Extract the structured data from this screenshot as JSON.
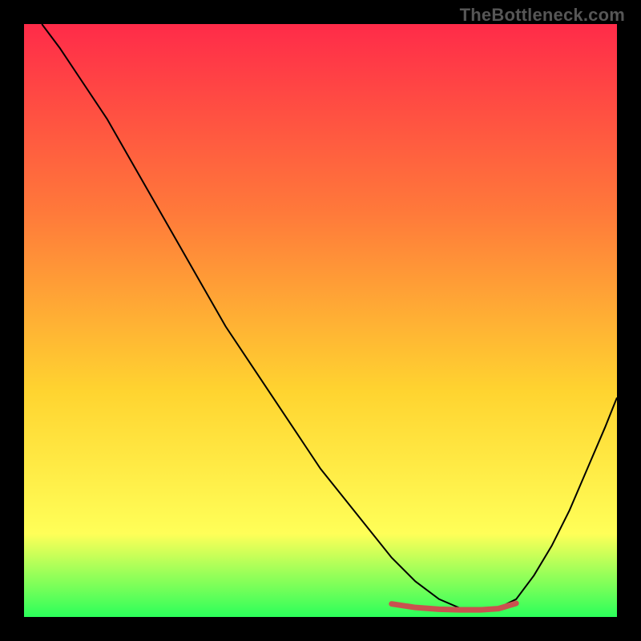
{
  "watermark": "TheBottleneck.com",
  "chart_data": {
    "type": "line",
    "title": "",
    "xlabel": "",
    "ylabel": "",
    "xlim": [
      0,
      100
    ],
    "ylim": [
      0,
      100
    ],
    "grid": false,
    "legend": false,
    "background_gradient": {
      "top": "#ff2b49",
      "mid1": "#ff7a3a",
      "mid2": "#ffd430",
      "mid3": "#ffff58",
      "bottom": "#2bff5a"
    },
    "series": [
      {
        "name": "curve",
        "color": "#000000",
        "width": 2,
        "x": [
          3,
          6,
          10,
          14,
          18,
          22,
          26,
          30,
          34,
          38,
          42,
          46,
          50,
          54,
          58,
          62,
          66,
          70,
          73.5,
          77,
          80,
          83,
          86,
          89,
          92,
          95,
          98,
          100
        ],
        "values": [
          100,
          96,
          90,
          84,
          77,
          70,
          63,
          56,
          49,
          43,
          37,
          31,
          25,
          20,
          15,
          10,
          6,
          3,
          1.5,
          1.5,
          1.5,
          3,
          7,
          12,
          18,
          25,
          32,
          37
        ]
      },
      {
        "name": "highlight-band",
        "color": "#c9524f",
        "width": 7,
        "linecap": "round",
        "x": [
          62,
          66,
          70,
          73.5,
          77,
          80,
          83
        ],
        "values": [
          2.2,
          1.6,
          1.3,
          1.2,
          1.2,
          1.4,
          2.3
        ]
      }
    ]
  }
}
